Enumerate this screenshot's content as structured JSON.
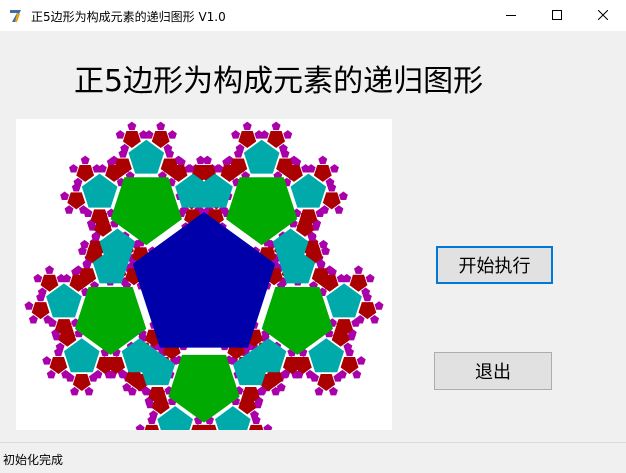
{
  "window": {
    "title": "正5边形为构成元素的递归图形 V1.0",
    "icon": "app-7-icon",
    "controls": {
      "minimize": "minimize-icon",
      "maximize": "maximize-icon",
      "close": "close-icon"
    }
  },
  "main": {
    "heading": "正5边形为构成元素的递归图形",
    "canvas": {
      "colors": {
        "level0": "#0000aa",
        "level1": "#00aa00",
        "level2": "#00aaaa",
        "level3": "#aa0000",
        "level4": "#aa00aa",
        "background": "#ffffff"
      }
    }
  },
  "buttons": {
    "start_label": "开始执行",
    "exit_label": "退出"
  },
  "status": {
    "text": "初始化完成"
  }
}
